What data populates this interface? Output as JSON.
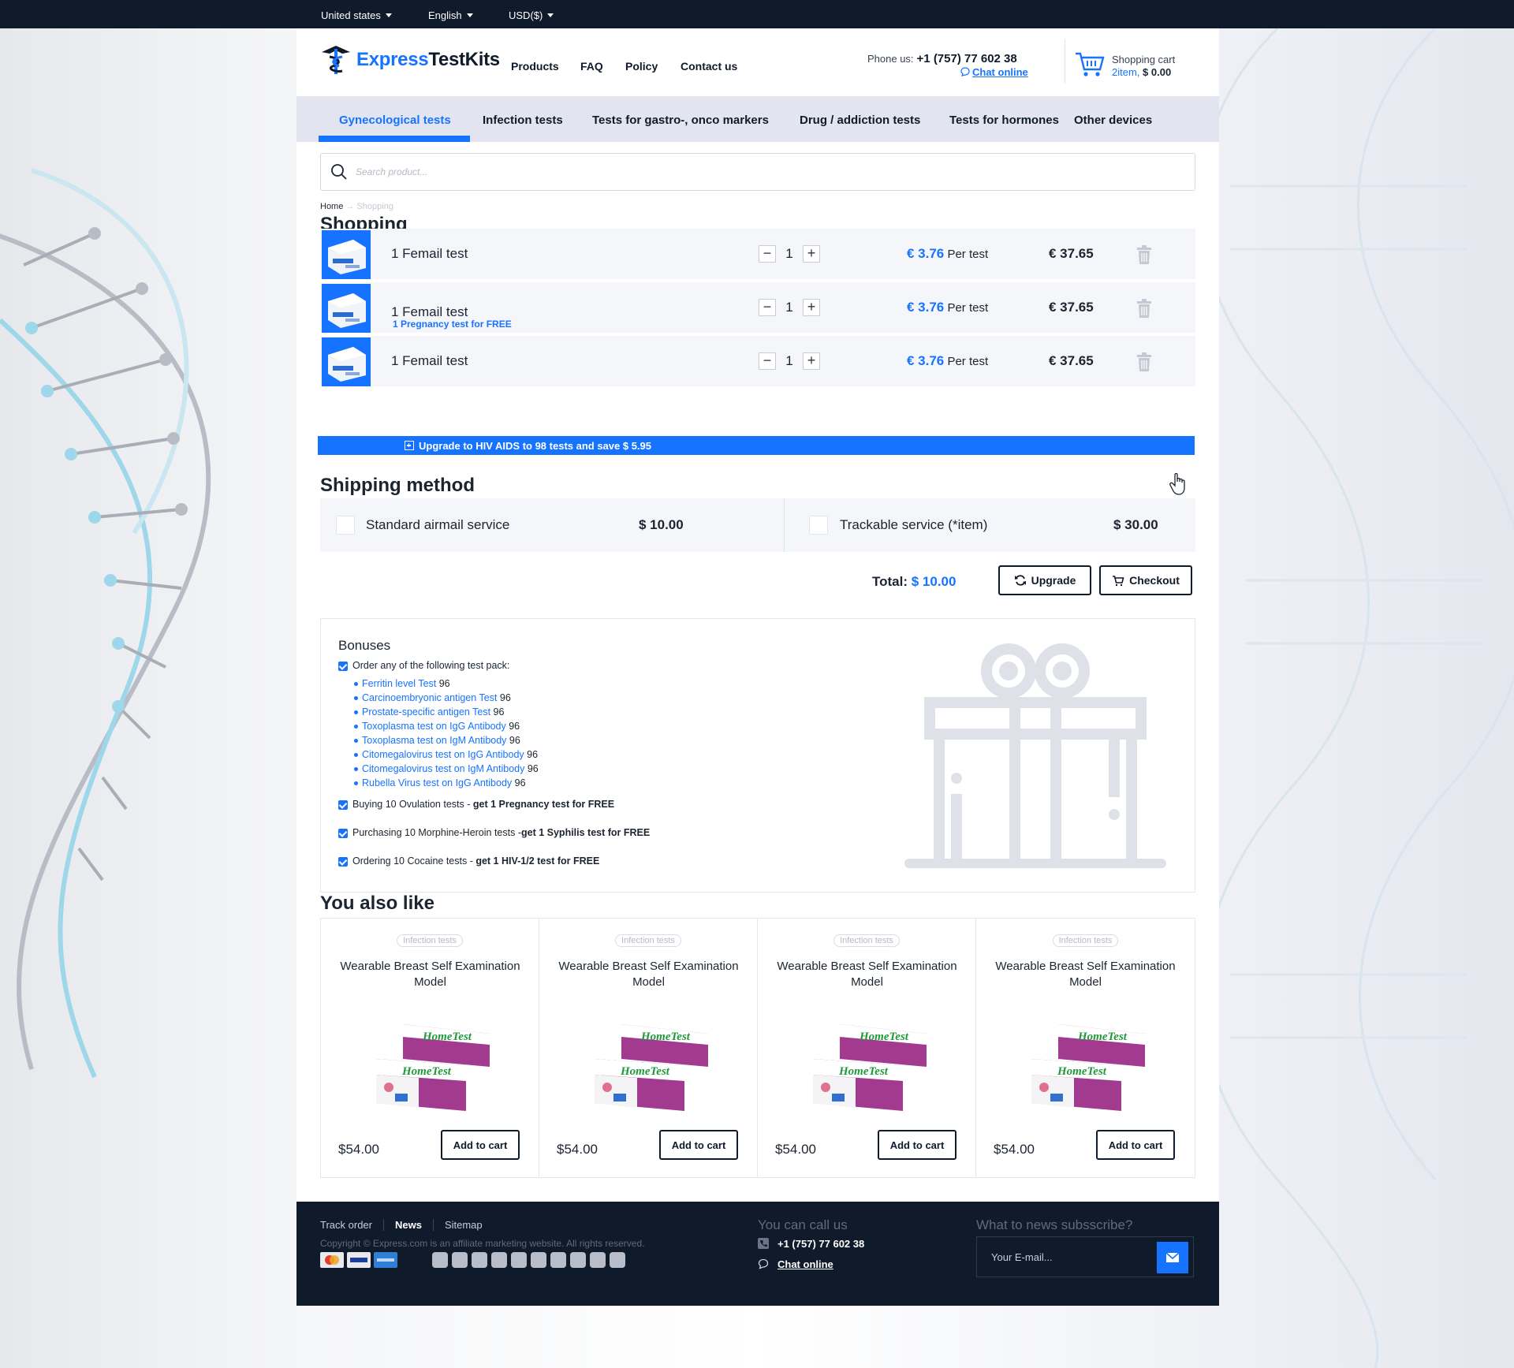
{
  "topbar": {
    "country": "United states",
    "language": "English",
    "currency": "USD($)"
  },
  "header": {
    "logo_part1": "Express",
    "logo_part2": "TestKits",
    "nav": [
      "Products",
      "FAQ",
      "Policy",
      "Contact us"
    ],
    "phone_label": "Phone us:",
    "phone": "+1 (757) 77 602 38",
    "chat": "Chat online",
    "cart_title": "Shopping cart",
    "cart_items": "2item,",
    "cart_amount": "$ 0.00"
  },
  "categories": [
    "Gynecological tests",
    "Infection tests",
    "Tests for gastro-, onco markers",
    "Drug / addiction tests",
    "Tests for hormones",
    "Other devices"
  ],
  "search": {
    "placeholder": "Search product..."
  },
  "breadcrumb": {
    "home": "Home",
    "sep": "→",
    "current": "Shopping"
  },
  "shopping": {
    "title": "Shopping",
    "per_label": "Per test",
    "items": [
      {
        "name": "1 Femail test",
        "sub": "",
        "qty": "1",
        "price": "€ 3.76",
        "total": "€ 37.65"
      },
      {
        "name": "1 Femail test",
        "sub": "1 Pregnancy test for FREE",
        "qty": "1",
        "price": "€ 3.76",
        "total": "€ 37.65"
      },
      {
        "name": "1 Femail test",
        "sub": "",
        "qty": "1",
        "price": "€ 3.76",
        "total": "€ 37.65"
      }
    ],
    "upgrade_bar": "Upgrade to HIV AIDS to 98 tests and save $ 5.95"
  },
  "shipping": {
    "title": "Shipping method",
    "options": [
      {
        "label": "Standard airmail service",
        "price": "$ 10.00"
      },
      {
        "label": "Trackable service (*item)",
        "price": "$ 30.00"
      }
    ]
  },
  "totals": {
    "label": "Total:",
    "value": "$ 10.00",
    "upgrade": "Upgrade",
    "checkout": "Checkout"
  },
  "bonuses": {
    "title": "Bonuses",
    "order_any": "Order any of the following test pack:",
    "tests": [
      {
        "name": "Ferritin level Test",
        "n": "96"
      },
      {
        "name": "Carcinoembryonic antigen Test",
        "n": "96"
      },
      {
        "name": " Prostate-specific antigen Test",
        "n": "96"
      },
      {
        "name": "Toxoplasma test on IgG Antibody",
        "n": "96"
      },
      {
        "name": "Toxoplasma test on IgM Antibody",
        "n": "96"
      },
      {
        "name": "Citomegalovirus test on IgG Antibody",
        "n": "96"
      },
      {
        "name": "Citomegalovirus test on IgM Antibody",
        "n": "96"
      },
      {
        "name": "Rubella Virus test on IgG Antibody",
        "n": "96"
      }
    ],
    "offers": [
      {
        "text": "Buying 10 Ovulation tests - ",
        "bold": "get 1 Pregnancy test for FREE"
      },
      {
        "text": "Purchasing 10 Morphine-Heroin tests -",
        "bold": "get 1 Syphilis test for FREE"
      },
      {
        "text": "Ordering 10 Cocaine tests - ",
        "bold": "get 1 HIV-1/2 test for FREE"
      }
    ]
  },
  "also_like": {
    "title": "You also like",
    "products": [
      {
        "tag": "Infection tests",
        "title": "Wearable Breast Self Examination Model",
        "price": "$54.00",
        "button": "Add to cart",
        "box_brand": "HomeTest"
      },
      {
        "tag": "Infection tests",
        "title": "Wearable Breast Self Examination Model",
        "price": "$54.00",
        "button": "Add to cart",
        "box_brand": "HomeTest"
      },
      {
        "tag": "Infection tests",
        "title": "Wearable Breast Self Examination Model",
        "price": "$54.00",
        "button": "Add to cart",
        "box_brand": "HomeTest"
      },
      {
        "tag": "Infection tests",
        "title": "Wearable Breast Self Examination Model",
        "price": "$54.00",
        "button": "Add to cart",
        "box_brand": "HomeTest"
      }
    ]
  },
  "footer": {
    "links": [
      "Track order",
      "News",
      "Sitemap"
    ],
    "copyright": "Copyright © Express.com is an affiliate marketing website. All rights reserved.",
    "call_title": "You can call us",
    "phone": "+1 (757) 77 602 38",
    "chat": "Chat online",
    "news_title": "What to news subsscribe?",
    "email_placeholder": "Your E-mail..."
  },
  "colors": {
    "accent": "#1673ff",
    "dark": "#0f1a2a",
    "row_bg": "#f4f6fa",
    "category_bar": "#e2e5f0"
  }
}
